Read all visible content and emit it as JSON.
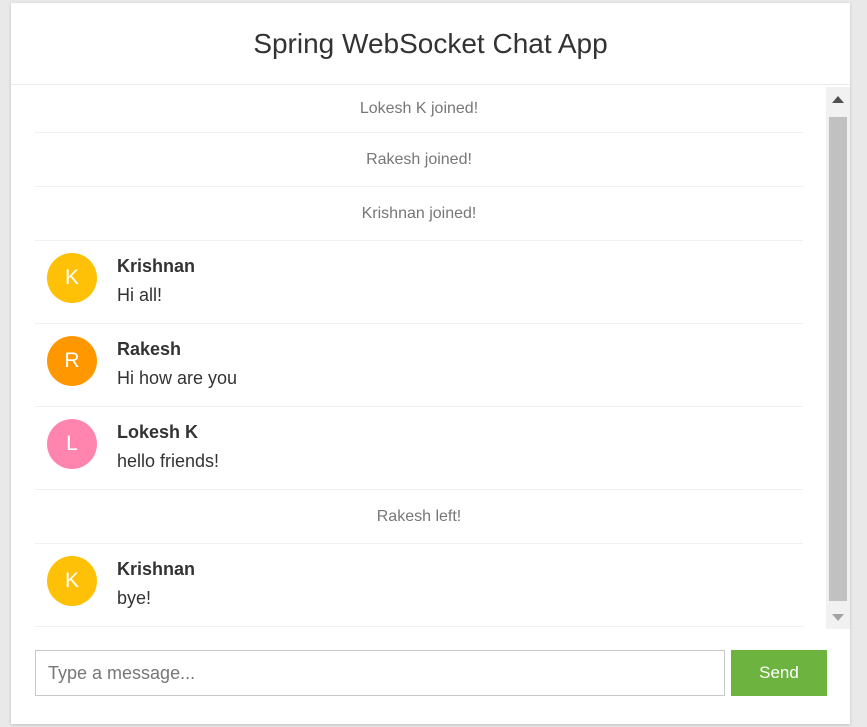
{
  "header": {
    "title": "Spring WebSocket Chat App"
  },
  "messages": [
    {
      "type": "event",
      "text": "Lokesh K joined!"
    },
    {
      "type": "event",
      "text": "Rakesh joined!"
    },
    {
      "type": "event",
      "text": "Krishnan joined!"
    },
    {
      "type": "chat",
      "initial": "K",
      "color": "#ffc107",
      "sender": "Krishnan",
      "content": "Hi all!"
    },
    {
      "type": "chat",
      "initial": "R",
      "color": "#ff9800",
      "sender": "Rakesh",
      "content": "Hi how are you"
    },
    {
      "type": "chat",
      "initial": "L",
      "color": "#ff85af",
      "sender": "Lokesh K",
      "content": "hello friends!"
    },
    {
      "type": "event",
      "text": "Rakesh left!"
    },
    {
      "type": "chat",
      "initial": "K",
      "color": "#ffc107",
      "sender": "Krishnan",
      "content": "bye!"
    }
  ],
  "composer": {
    "placeholder": "Type a message...",
    "send_label": "Send"
  },
  "colors": {
    "accent": "#6db33f"
  }
}
